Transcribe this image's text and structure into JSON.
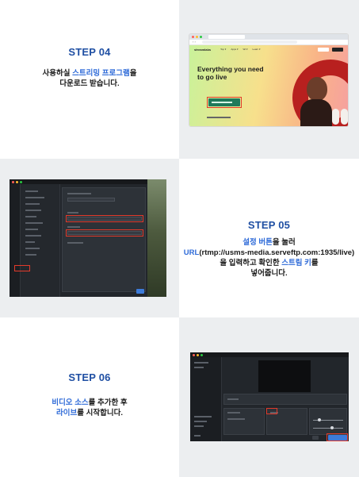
{
  "step04": {
    "title": "STEP 04",
    "desc_line1_pre": "사용하실 ",
    "desc_line1_hl": "스트리밍 프로그램",
    "desc_line1_post": "을",
    "desc_line2": "다운로드 받습니다.",
    "browser": {
      "brand": "streamlabs",
      "nav": [
        "Top ▾",
        "Apps ▾",
        "Wt ▾",
        "Learn ▾"
      ],
      "headline": "Everything you need to go live"
    }
  },
  "step05": {
    "title": "STEP 05",
    "line1_hl": "설정 버튼",
    "line1_post": "을 눌러",
    "line2_hl": "URL",
    "line2_post": "(rtmp://usms-media.serveftp.com:1935/live)",
    "line3_pre": "을 입력하고 확인한 ",
    "line3_hl": "스트림 키",
    "line3_post": "를",
    "line4": "넣어줍니다."
  },
  "step06": {
    "title": "STEP 06",
    "line1_hl": "비디오 소스",
    "line1_post": "를 추가한 후",
    "line2_hl": "라이브",
    "line2_post": "를 시작합니다."
  },
  "colors": {
    "title_blue": "#1f4fa3",
    "highlight_blue": "#2f6bd8",
    "panel_grey": "#eceef0",
    "outline_red": "#e23a2b"
  }
}
